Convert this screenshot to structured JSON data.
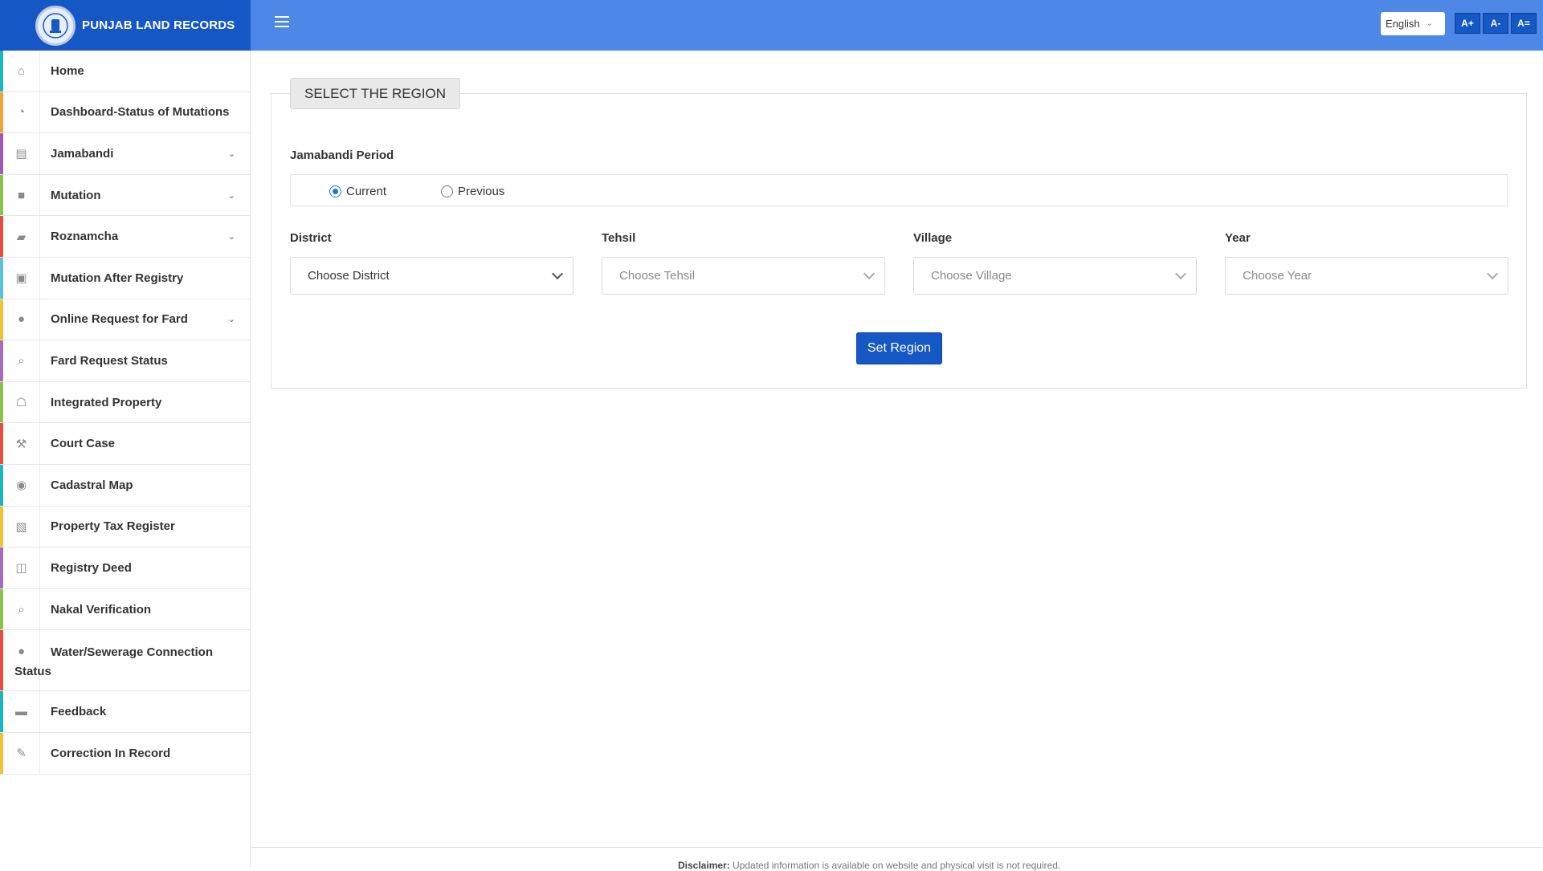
{
  "header": {
    "brand": "PUNJAB LAND RECORDS",
    "language": "English",
    "font_buttons": [
      "A+",
      "A-",
      "A="
    ],
    "colors": {
      "header_bg": "#4d88e6",
      "brand_bg": "#1557c4"
    }
  },
  "sidebar": {
    "items": [
      {
        "label": "Home",
        "icon": "home-icon",
        "color": "#1ab7c2",
        "has_caret": false
      },
      {
        "label": "Dashboard-Status of Mutations",
        "icon": "dashboard-icon",
        "color": "#f0a33a",
        "has_caret": false
      },
      {
        "label": "Jamabandi",
        "icon": "id-card-icon",
        "color": "#9b59b6",
        "has_caret": true
      },
      {
        "label": "Mutation",
        "icon": "file-icon",
        "color": "#8bc34a",
        "has_caret": true
      },
      {
        "label": "Roznamcha",
        "icon": "book-icon",
        "color": "#e74c3c",
        "has_caret": true
      },
      {
        "label": "Mutation After Registry",
        "icon": "briefcase-icon",
        "color": "#5bc0de",
        "has_caret": false
      },
      {
        "label": "Online Request for Fard",
        "icon": "drop-icon",
        "color": "#f0c23a",
        "has_caret": true
      },
      {
        "label": "Fard Request Status",
        "icon": "search-icon",
        "color": "#a66bbe",
        "has_caret": false
      },
      {
        "label": "Integrated Property",
        "icon": "bank-icon",
        "color": "#8bc34a",
        "has_caret": false
      },
      {
        "label": "Court Case",
        "icon": "gavel-icon",
        "color": "#e74c3c",
        "has_caret": false
      },
      {
        "label": "Cadastral Map",
        "icon": "map-pin-icon",
        "color": "#1ab7c2",
        "has_caret": false
      },
      {
        "label": "Property Tax Register",
        "icon": "edit-box-icon",
        "color": "#f0c23a",
        "has_caret": false
      },
      {
        "label": "Registry Deed",
        "icon": "copy-icon",
        "color": "#a66bbe",
        "has_caret": false
      },
      {
        "label": "Nakal Verification",
        "icon": "search-icon",
        "color": "#8bc34a",
        "has_caret": false
      },
      {
        "label": "Water/Sewerage Connection",
        "label_line2": "Status",
        "icon": "drop-icon",
        "color": "#e74c3c",
        "has_caret": false
      },
      {
        "label": "Feedback",
        "icon": "comments-icon",
        "color": "#1ab7c2",
        "has_caret": false
      },
      {
        "label": "Correction In Record",
        "icon": "pencil-square-icon",
        "color": "#f0c23a",
        "has_caret": false
      }
    ]
  },
  "main": {
    "legend": "SELECT THE REGION",
    "period_label": "Jamabandi Period",
    "period_options": [
      "Current",
      "Previous"
    ],
    "period_selected": "Current",
    "fields": [
      {
        "label": "District",
        "placeholder": "Choose District"
      },
      {
        "label": "Tehsil",
        "placeholder": "Choose Tehsil"
      },
      {
        "label": "Village",
        "placeholder": "Choose Village"
      },
      {
        "label": "Year",
        "placeholder": "Choose Year"
      }
    ],
    "submit_label": "Set Region"
  },
  "footer": {
    "disclaimer_label": "Disclaimer:",
    "disclaimer_text": "Updated information is available on website and physical visit is not required."
  }
}
